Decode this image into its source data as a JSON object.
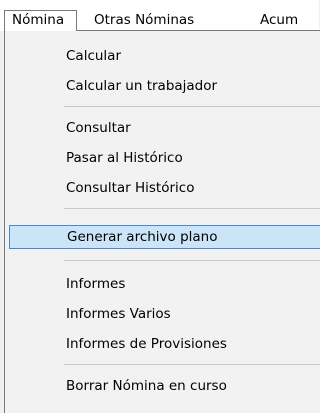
{
  "menubar": {
    "items": [
      {
        "label": "Nómina"
      },
      {
        "label": "Otras Nóminas"
      },
      {
        "label": "Acum"
      }
    ]
  },
  "dropdown": {
    "items": [
      {
        "label": "Calcular"
      },
      {
        "label": "Calcular un trabajador"
      },
      {
        "label": "Consultar"
      },
      {
        "label": "Pasar al Histórico"
      },
      {
        "label": "Consultar Histórico"
      },
      {
        "label": "Generar archivo plano"
      },
      {
        "label": "Informes"
      },
      {
        "label": "Informes Varios"
      },
      {
        "label": "Informes de Provisiones"
      },
      {
        "label": "Borrar Nómina en curso"
      }
    ],
    "highlighted_index": 5
  }
}
